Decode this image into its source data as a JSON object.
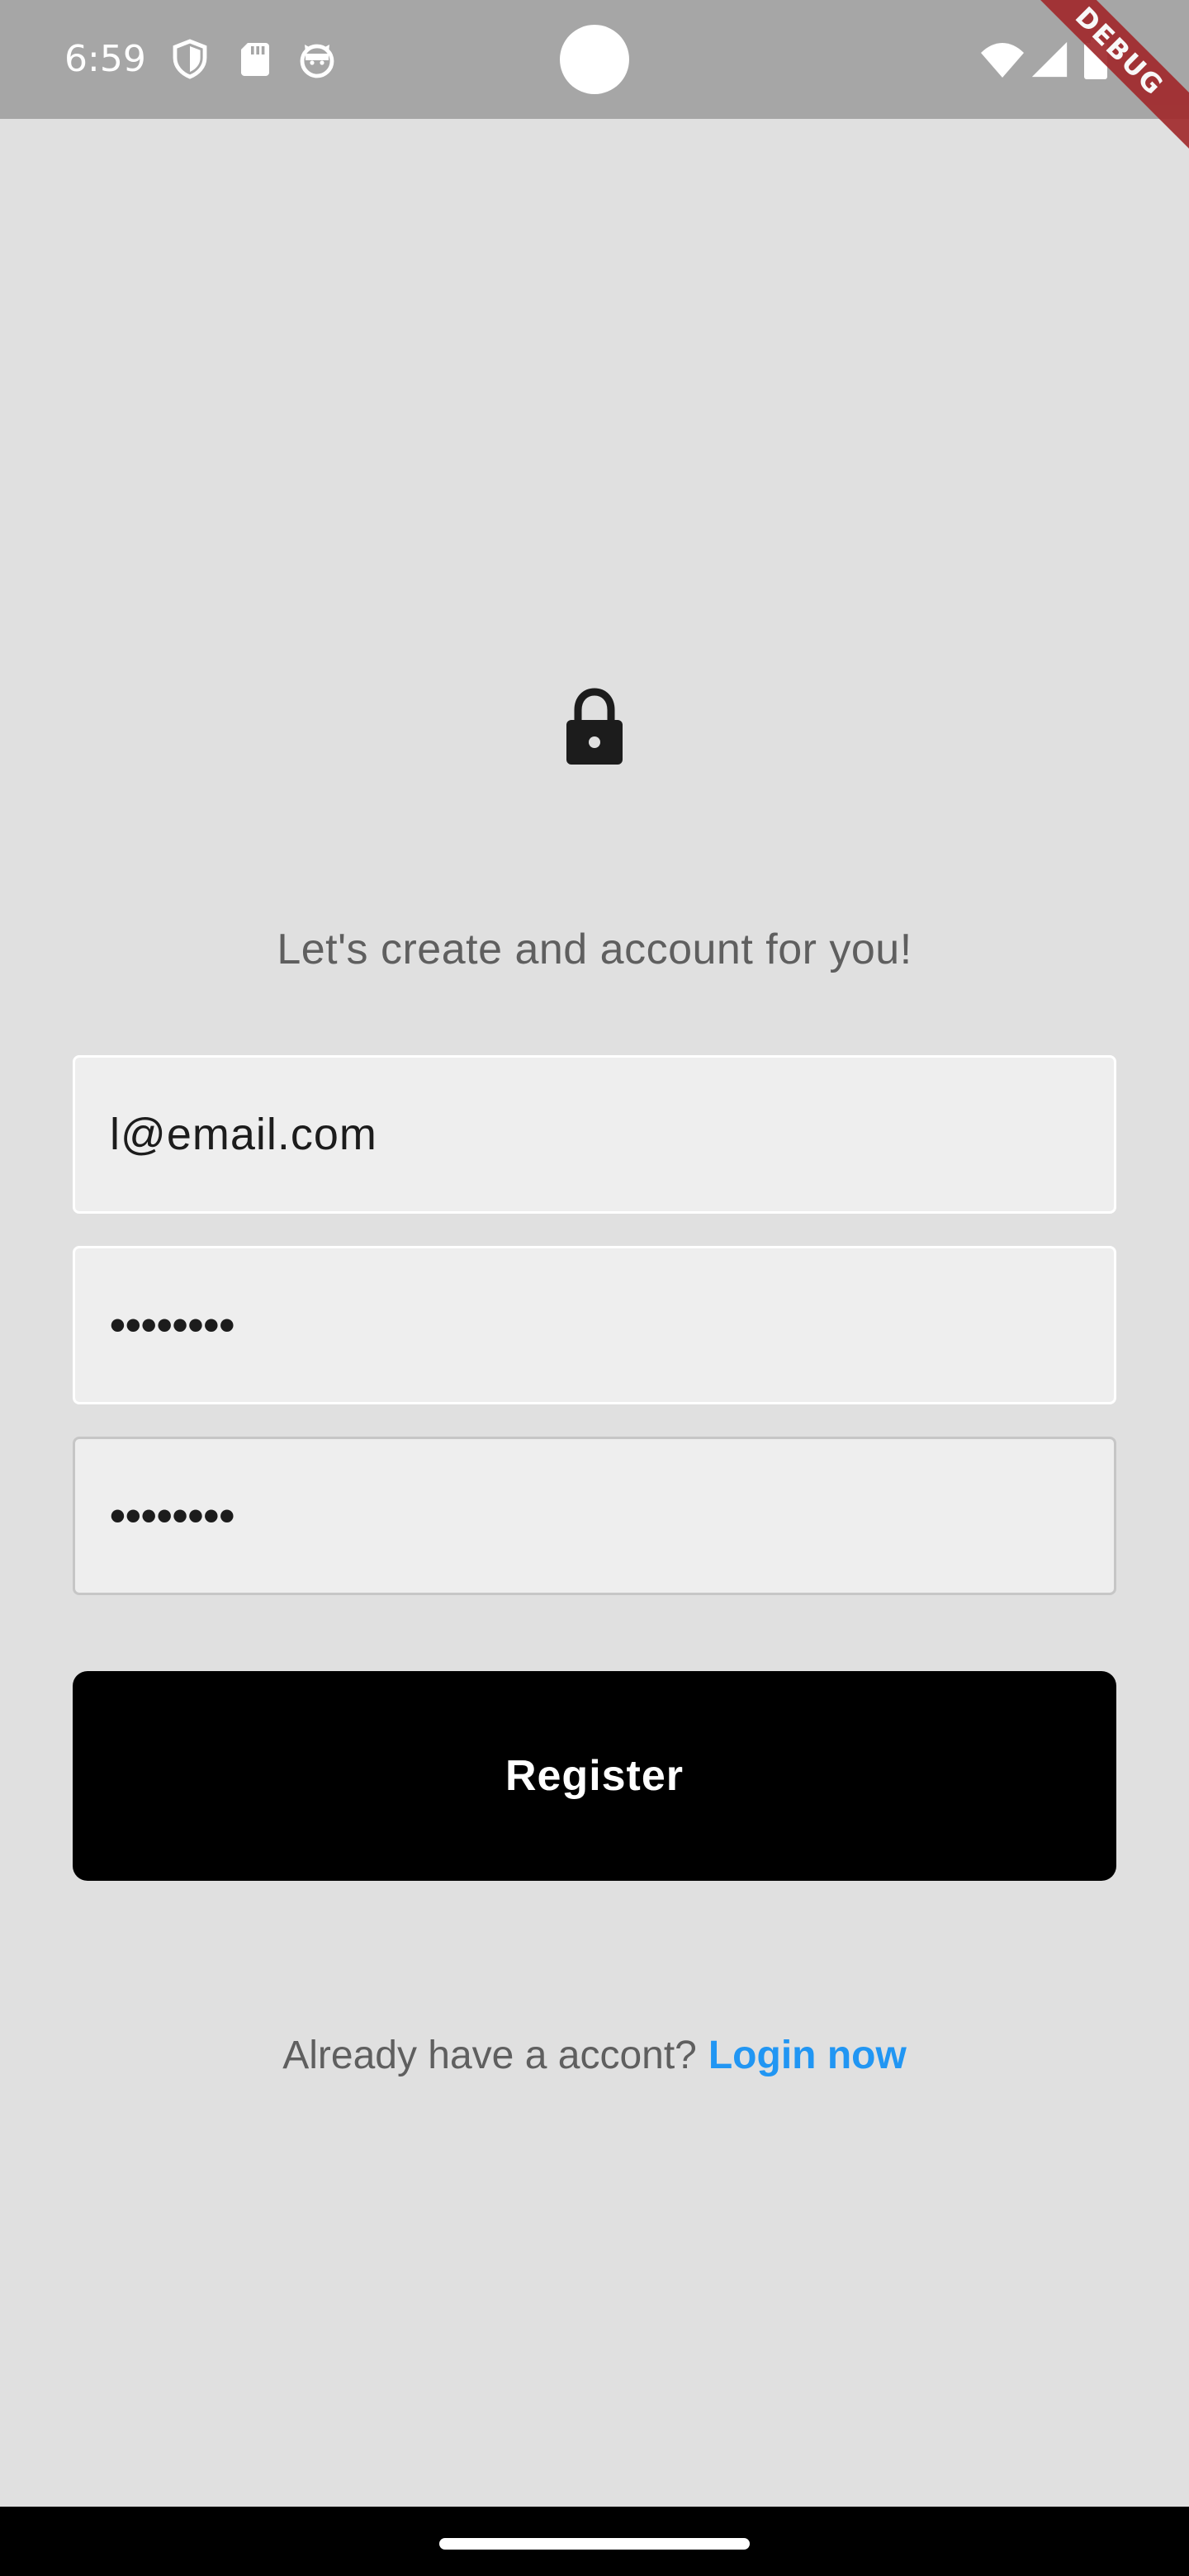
{
  "status_bar": {
    "time": "6:59",
    "left_icons": [
      "shield-icon",
      "sd-card-icon",
      "cat-face-icon"
    ],
    "right_icons": [
      "wifi-icon",
      "cell-signal-icon",
      "battery-icon"
    ],
    "debug_label": "DEBUG",
    "colors": {
      "background": "#a6a6a6",
      "debug_banner": "#a12a2d"
    }
  },
  "header": {
    "icon": "lock-icon",
    "subtitle": "Let's create and account for you!"
  },
  "form": {
    "email": {
      "value": "l@email.com"
    },
    "password": {
      "value": "••••••••"
    },
    "confirm_password": {
      "value": "••••••••"
    },
    "register_label": "Register"
  },
  "footer": {
    "prompt": "Already have a accont?",
    "link": "Login now",
    "link_color": "#2196f3"
  }
}
